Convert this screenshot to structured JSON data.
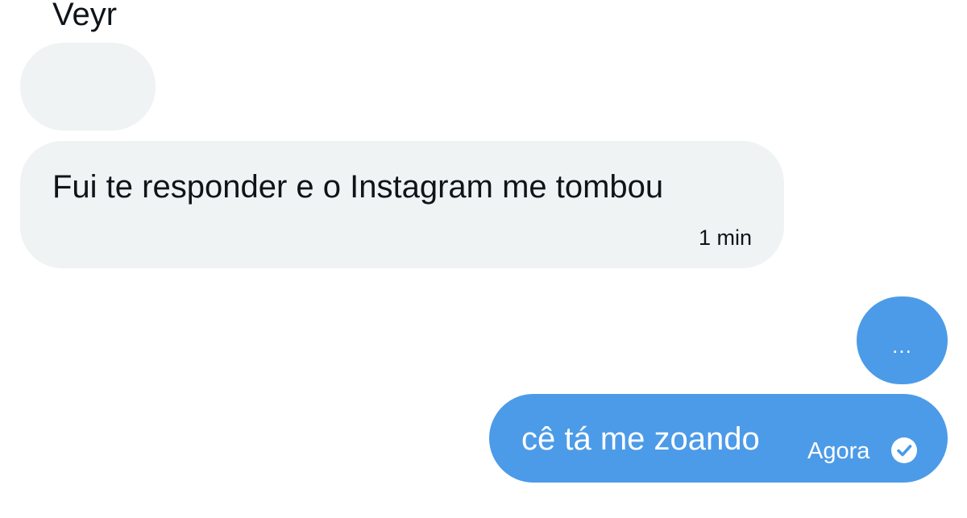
{
  "messages": [
    {
      "direction": "incoming",
      "text": "Veyr"
    },
    {
      "direction": "incoming",
      "text": "Fui te responder e o Instagram me tombou",
      "time": "1 min"
    },
    {
      "direction": "outgoing",
      "text": "..."
    },
    {
      "direction": "outgoing",
      "text": "cê tá me zoando",
      "time": "Agora",
      "status_icon": "sent-check-icon"
    }
  ],
  "colors": {
    "incoming_bubble": "#eff3f4",
    "outgoing_bubble": "#4c9be8",
    "incoming_text": "#0f1419",
    "outgoing_text": "#ffffff"
  }
}
